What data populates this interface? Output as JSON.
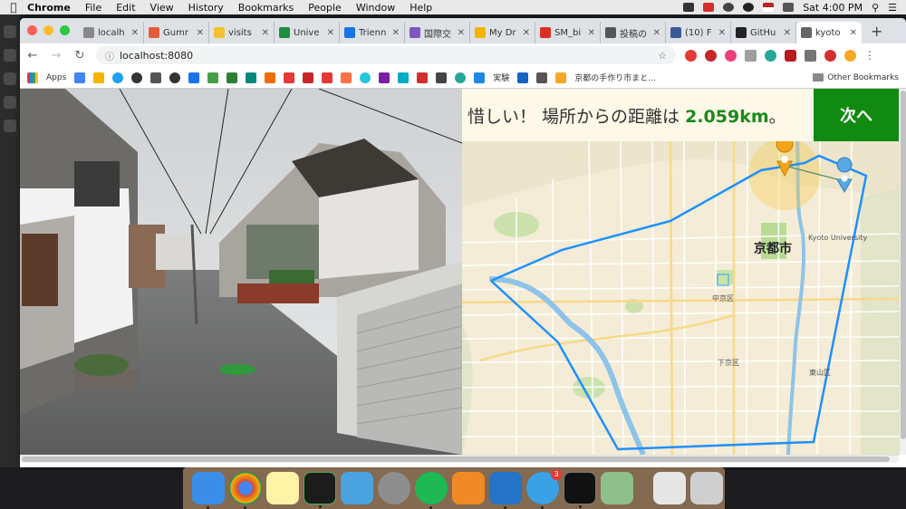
{
  "menubar": {
    "app": "Chrome",
    "items": [
      "File",
      "Edit",
      "View",
      "History",
      "Bookmarks",
      "People",
      "Window",
      "Help"
    ],
    "clock": "Sat 4:00 PM"
  },
  "browser": {
    "tabs": [
      {
        "label": "localh",
        "fav": "#888"
      },
      {
        "label": "Gumr",
        "fav": "#e45b3c"
      },
      {
        "label": "visits",
        "fav": "#f1c232"
      },
      {
        "label": "Unive",
        "fav": "#1e8e3e"
      },
      {
        "label": "Trienn",
        "fav": "#1a73e8"
      },
      {
        "label": "国際交",
        "fav": "#7e57c2"
      },
      {
        "label": "My Dr",
        "fav": "#f4b400"
      },
      {
        "label": "SM_bi",
        "fav": "#d93025"
      },
      {
        "label": "投稿の",
        "fav": "#555"
      },
      {
        "label": "(10) F",
        "fav": "#3b5998"
      },
      {
        "label": "GitHu",
        "fav": "#222"
      },
      {
        "label": "kyoto",
        "fav": "#666",
        "active": true
      }
    ],
    "url": "localhost:8080",
    "bookmarks": {
      "apps_label": "Apps",
      "jp_label": "実験",
      "kyoto_label": "京都の手作り市まと...",
      "other_label": "Other Bookmarks"
    }
  },
  "game": {
    "result_prefix": "惜しい！ 場所からの距離は ",
    "distance": "2.059km",
    "result_suffix": "。",
    "next_label": "次へ",
    "map_labels": {
      "city": "京都市",
      "university": "Kyoto University",
      "nakagyo": "中京区",
      "shimogyo": "下京区",
      "higashiyama": "東山区"
    }
  },
  "dock": {
    "spotlight_badge": "3"
  }
}
